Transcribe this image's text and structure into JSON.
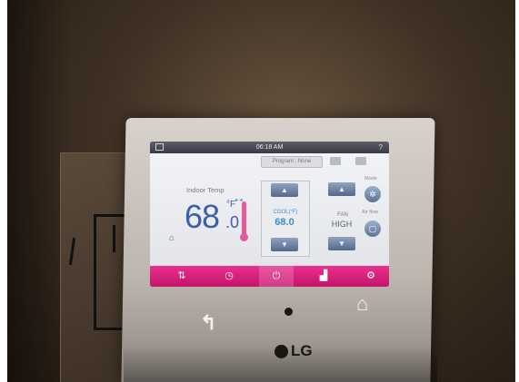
{
  "status_bar": {
    "time": "06:18 AM",
    "help": "?"
  },
  "program": {
    "label": "Program : None"
  },
  "indoor": {
    "label": "Indoor Temp",
    "value": "68",
    "decimal": ".0",
    "unit": "°F"
  },
  "setpoint": {
    "mode_label": "COOL(°F)",
    "value": "68.0"
  },
  "fan": {
    "label": "FAN",
    "speed": "HIGH"
  },
  "side_labels": {
    "mode": "Mode",
    "airflow": "Air flow"
  },
  "device": {
    "logo": "LG"
  },
  "colors": {
    "accent_pink": "#d81e7a",
    "temp_blue": "#3b5fa8",
    "cool_blue": "#3a8fd0"
  }
}
